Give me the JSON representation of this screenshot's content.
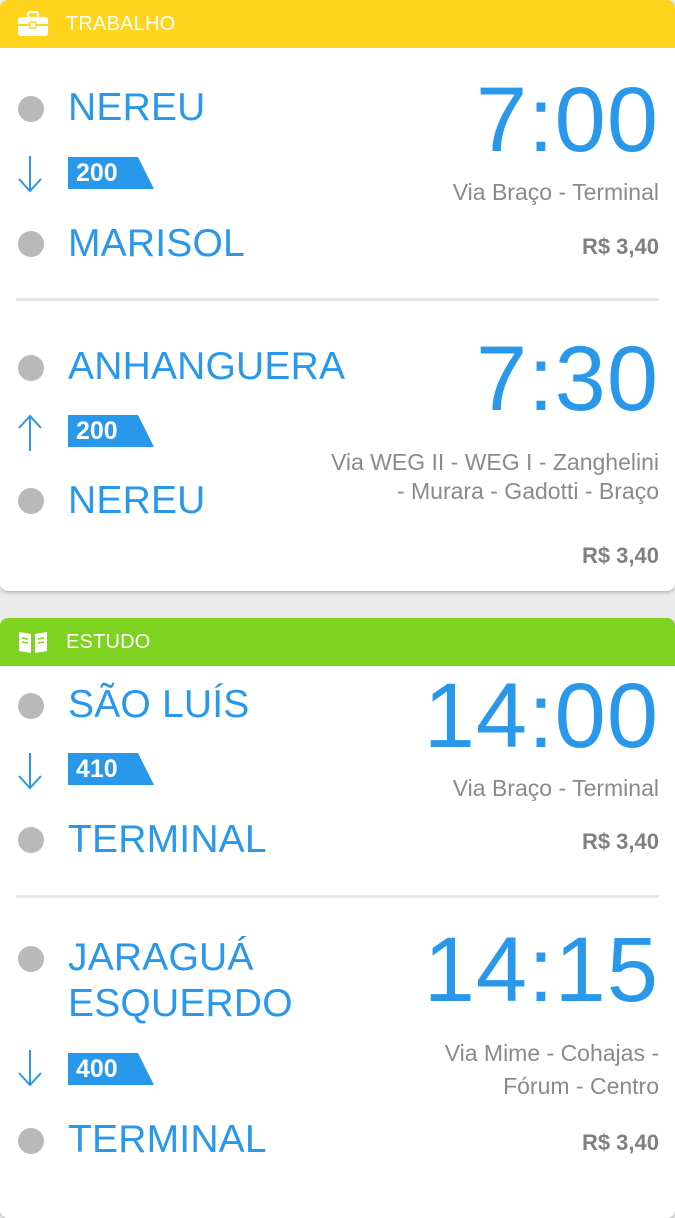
{
  "colors": {
    "work_header": "#ffd41c",
    "study_header": "#7ed321",
    "accent_blue": "#2a98ea",
    "stop_dot": "#b9b9b9",
    "muted_text": "#8a8a8a"
  },
  "sections": [
    {
      "title": "TRABALHO",
      "icon": "briefcase-icon",
      "trips": [
        {
          "origin": "NEREU",
          "destination": "MARISOL",
          "direction": "down-arrow-icon",
          "line": "200",
          "time": "7:00",
          "via": "Via Braço - Terminal",
          "fare": "R$ 3,40"
        },
        {
          "origin": "ANHANGUERA",
          "destination": "NEREU",
          "direction": "up-arrow-icon",
          "line": "200",
          "time": "7:30",
          "via_line1": "Via WEG II - WEG I - Zanghelini",
          "via_line2": "- Murara - Gadotti - Braço",
          "fare": "R$ 3,40"
        }
      ]
    },
    {
      "title": "ESTUDO",
      "icon": "open-book-icon",
      "trips": [
        {
          "origin": "SÃO LUÍS",
          "destination": "TERMINAL",
          "direction": "down-arrow-icon",
          "line": "410",
          "time": "14:00",
          "via": "Via Braço - Terminal",
          "fare": "R$ 3,40"
        },
        {
          "origin_line1": "JARAGUÁ",
          "origin_line2": "ESQUERDO",
          "destination": "TERMINAL",
          "direction": "down-arrow-icon",
          "line": "400",
          "time": "14:15",
          "via_line1": "Via Mime - Cohajas -",
          "via_line2": "Fórum - Centro",
          "fare": "R$ 3,40"
        }
      ]
    }
  ]
}
